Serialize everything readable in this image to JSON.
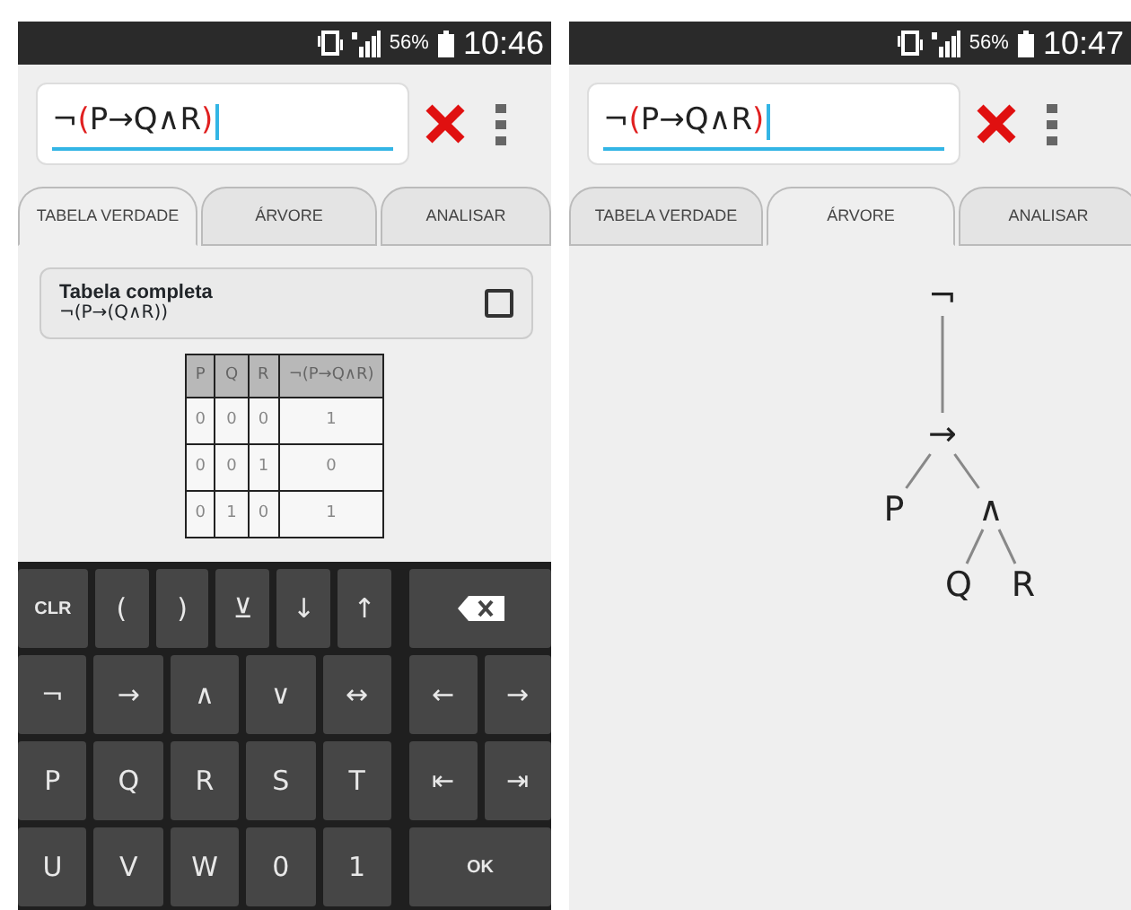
{
  "screens": [
    {
      "status_bar": {
        "battery": "56%",
        "time": "10:46"
      },
      "formula": [
        {
          "text": "¬",
          "highlight": false
        },
        {
          "text": "(",
          "highlight": true
        },
        {
          "text": "P→Q∧R",
          "highlight": false
        },
        {
          "text": ")",
          "highlight": true
        }
      ],
      "tabs": [
        {
          "label": "TABELA VERDADE",
          "selected": true
        },
        {
          "label": "ÁRVORE",
          "selected": false
        },
        {
          "label": "ANALISAR",
          "selected": false
        }
      ],
      "table_option": {
        "title": "Tabela completa",
        "formula": "¬(P→(Q∧R))",
        "checked": false
      },
      "truth_table": {
        "columns": [
          "P",
          "Q",
          "R",
          "¬(P→Q∧R)"
        ],
        "rows": [
          [
            "0",
            "0",
            "0",
            "1"
          ],
          [
            "0",
            "0",
            "1",
            "0"
          ],
          [
            "0",
            "1",
            "0",
            "1"
          ]
        ]
      },
      "keyboard": {
        "rows": [
          {
            "left": [
              {
                "kind": "text",
                "label": "CLR"
              },
              {
                "kind": "text",
                "label": "("
              },
              {
                "kind": "text",
                "label": ")"
              },
              {
                "kind": "text",
                "label": "⊻"
              },
              {
                "kind": "text",
                "label": "↓"
              },
              {
                "kind": "text",
                "label": "↑"
              }
            ],
            "right": [
              {
                "kind": "backspace"
              }
            ]
          },
          {
            "left": [
              {
                "kind": "text",
                "label": "¬"
              },
              {
                "kind": "text",
                "label": "→"
              },
              {
                "kind": "text",
                "label": "∧"
              },
              {
                "kind": "text",
                "label": "∨"
              },
              {
                "kind": "text",
                "label": "↔"
              }
            ],
            "right": [
              {
                "kind": "text",
                "label": "←"
              },
              {
                "kind": "text",
                "label": "→"
              }
            ]
          },
          {
            "left": [
              {
                "kind": "text",
                "label": "P"
              },
              {
                "kind": "text",
                "label": "Q"
              },
              {
                "kind": "text",
                "label": "R"
              },
              {
                "kind": "text",
                "label": "S"
              },
              {
                "kind": "text",
                "label": "T"
              }
            ],
            "right": [
              {
                "kind": "text",
                "label": "⇤"
              },
              {
                "kind": "text",
                "label": "⇥"
              }
            ]
          },
          {
            "left": [
              {
                "kind": "text",
                "label": "U"
              },
              {
                "kind": "text",
                "label": "V"
              },
              {
                "kind": "text",
                "label": "W"
              },
              {
                "kind": "text",
                "label": "0"
              },
              {
                "kind": "text",
                "label": "1"
              }
            ],
            "right": [
              {
                "kind": "text",
                "label": "OK"
              }
            ]
          }
        ]
      }
    },
    {
      "status_bar": {
        "battery": "56%",
        "time": "10:47"
      },
      "formula": [
        {
          "text": "¬",
          "highlight": false
        },
        {
          "text": "(",
          "highlight": true
        },
        {
          "text": "P→Q∧R",
          "highlight": false
        },
        {
          "text": ")",
          "highlight": true
        }
      ],
      "tabs": [
        {
          "label": "TABELA VERDADE",
          "selected": false
        },
        {
          "label": "ÁRVORE",
          "selected": true
        },
        {
          "label": "ANALISAR",
          "selected": false
        }
      ],
      "tree": {
        "label": "¬",
        "children": [
          {
            "label": "→",
            "children": [
              {
                "label": "P"
              },
              {
                "label": "∧",
                "children": [
                  {
                    "label": "Q"
                  },
                  {
                    "label": "R"
                  }
                ]
              }
            ]
          }
        ]
      }
    }
  ]
}
